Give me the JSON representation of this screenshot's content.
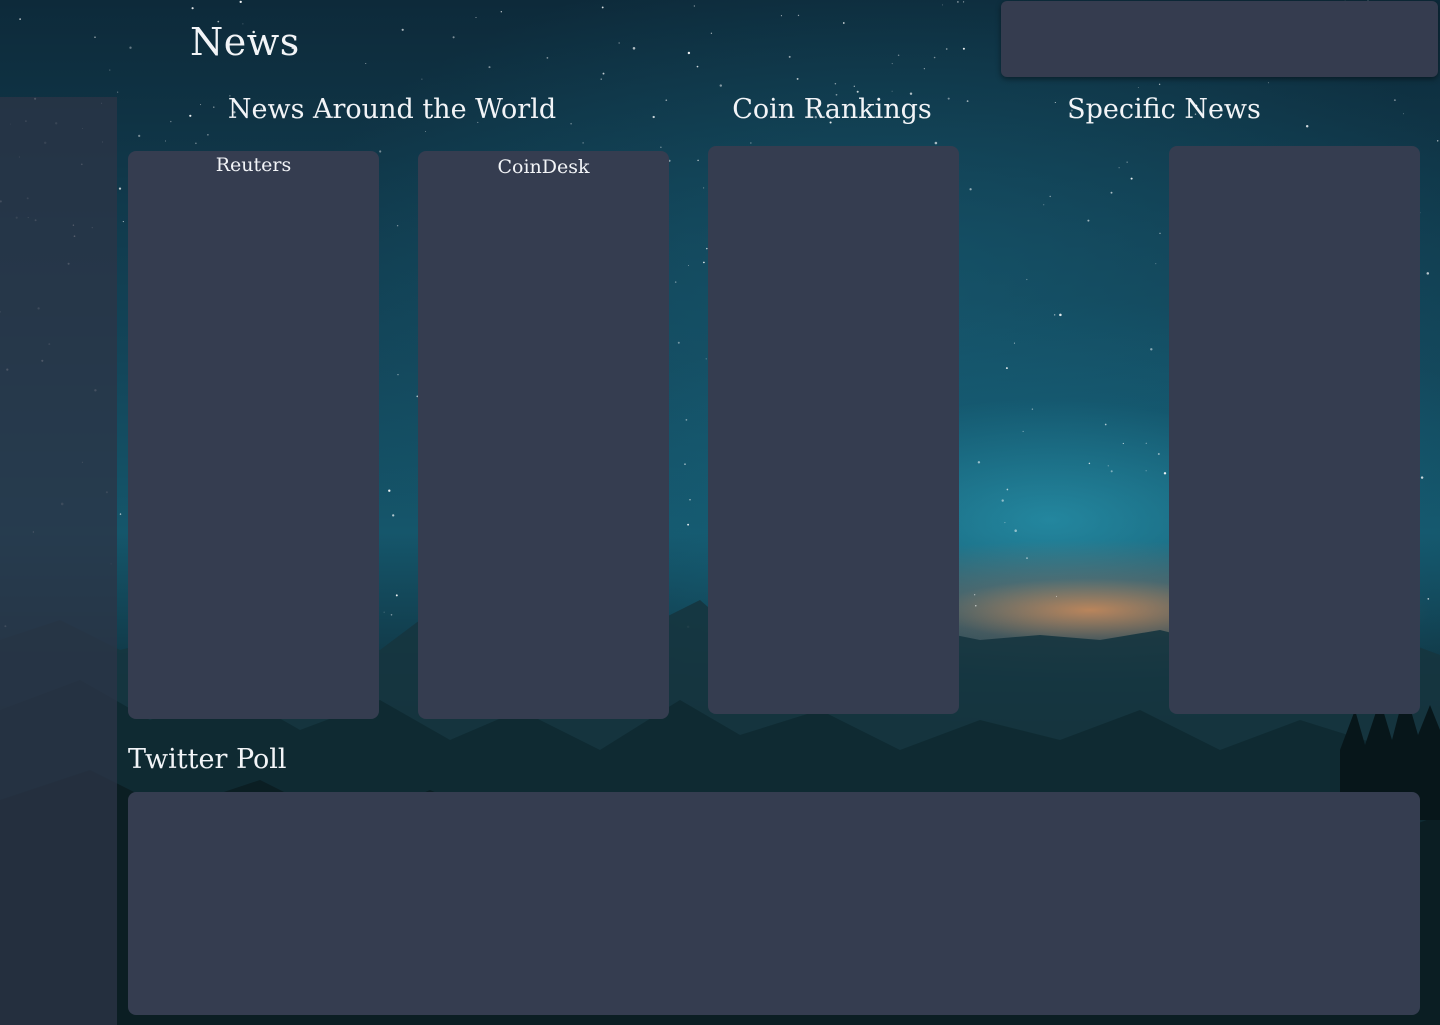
{
  "header": {
    "title": "News"
  },
  "sections": {
    "news_around_world": "News Around the World",
    "coin_rankings": "Coin Rankings",
    "specific_news": "Specific News",
    "twitter_poll": "Twitter Poll"
  },
  "feeds": {
    "reuters": "Reuters",
    "coindesk": "CoinDesk"
  },
  "colors": {
    "panel": "#353d50",
    "text": "#f2f4f7"
  }
}
